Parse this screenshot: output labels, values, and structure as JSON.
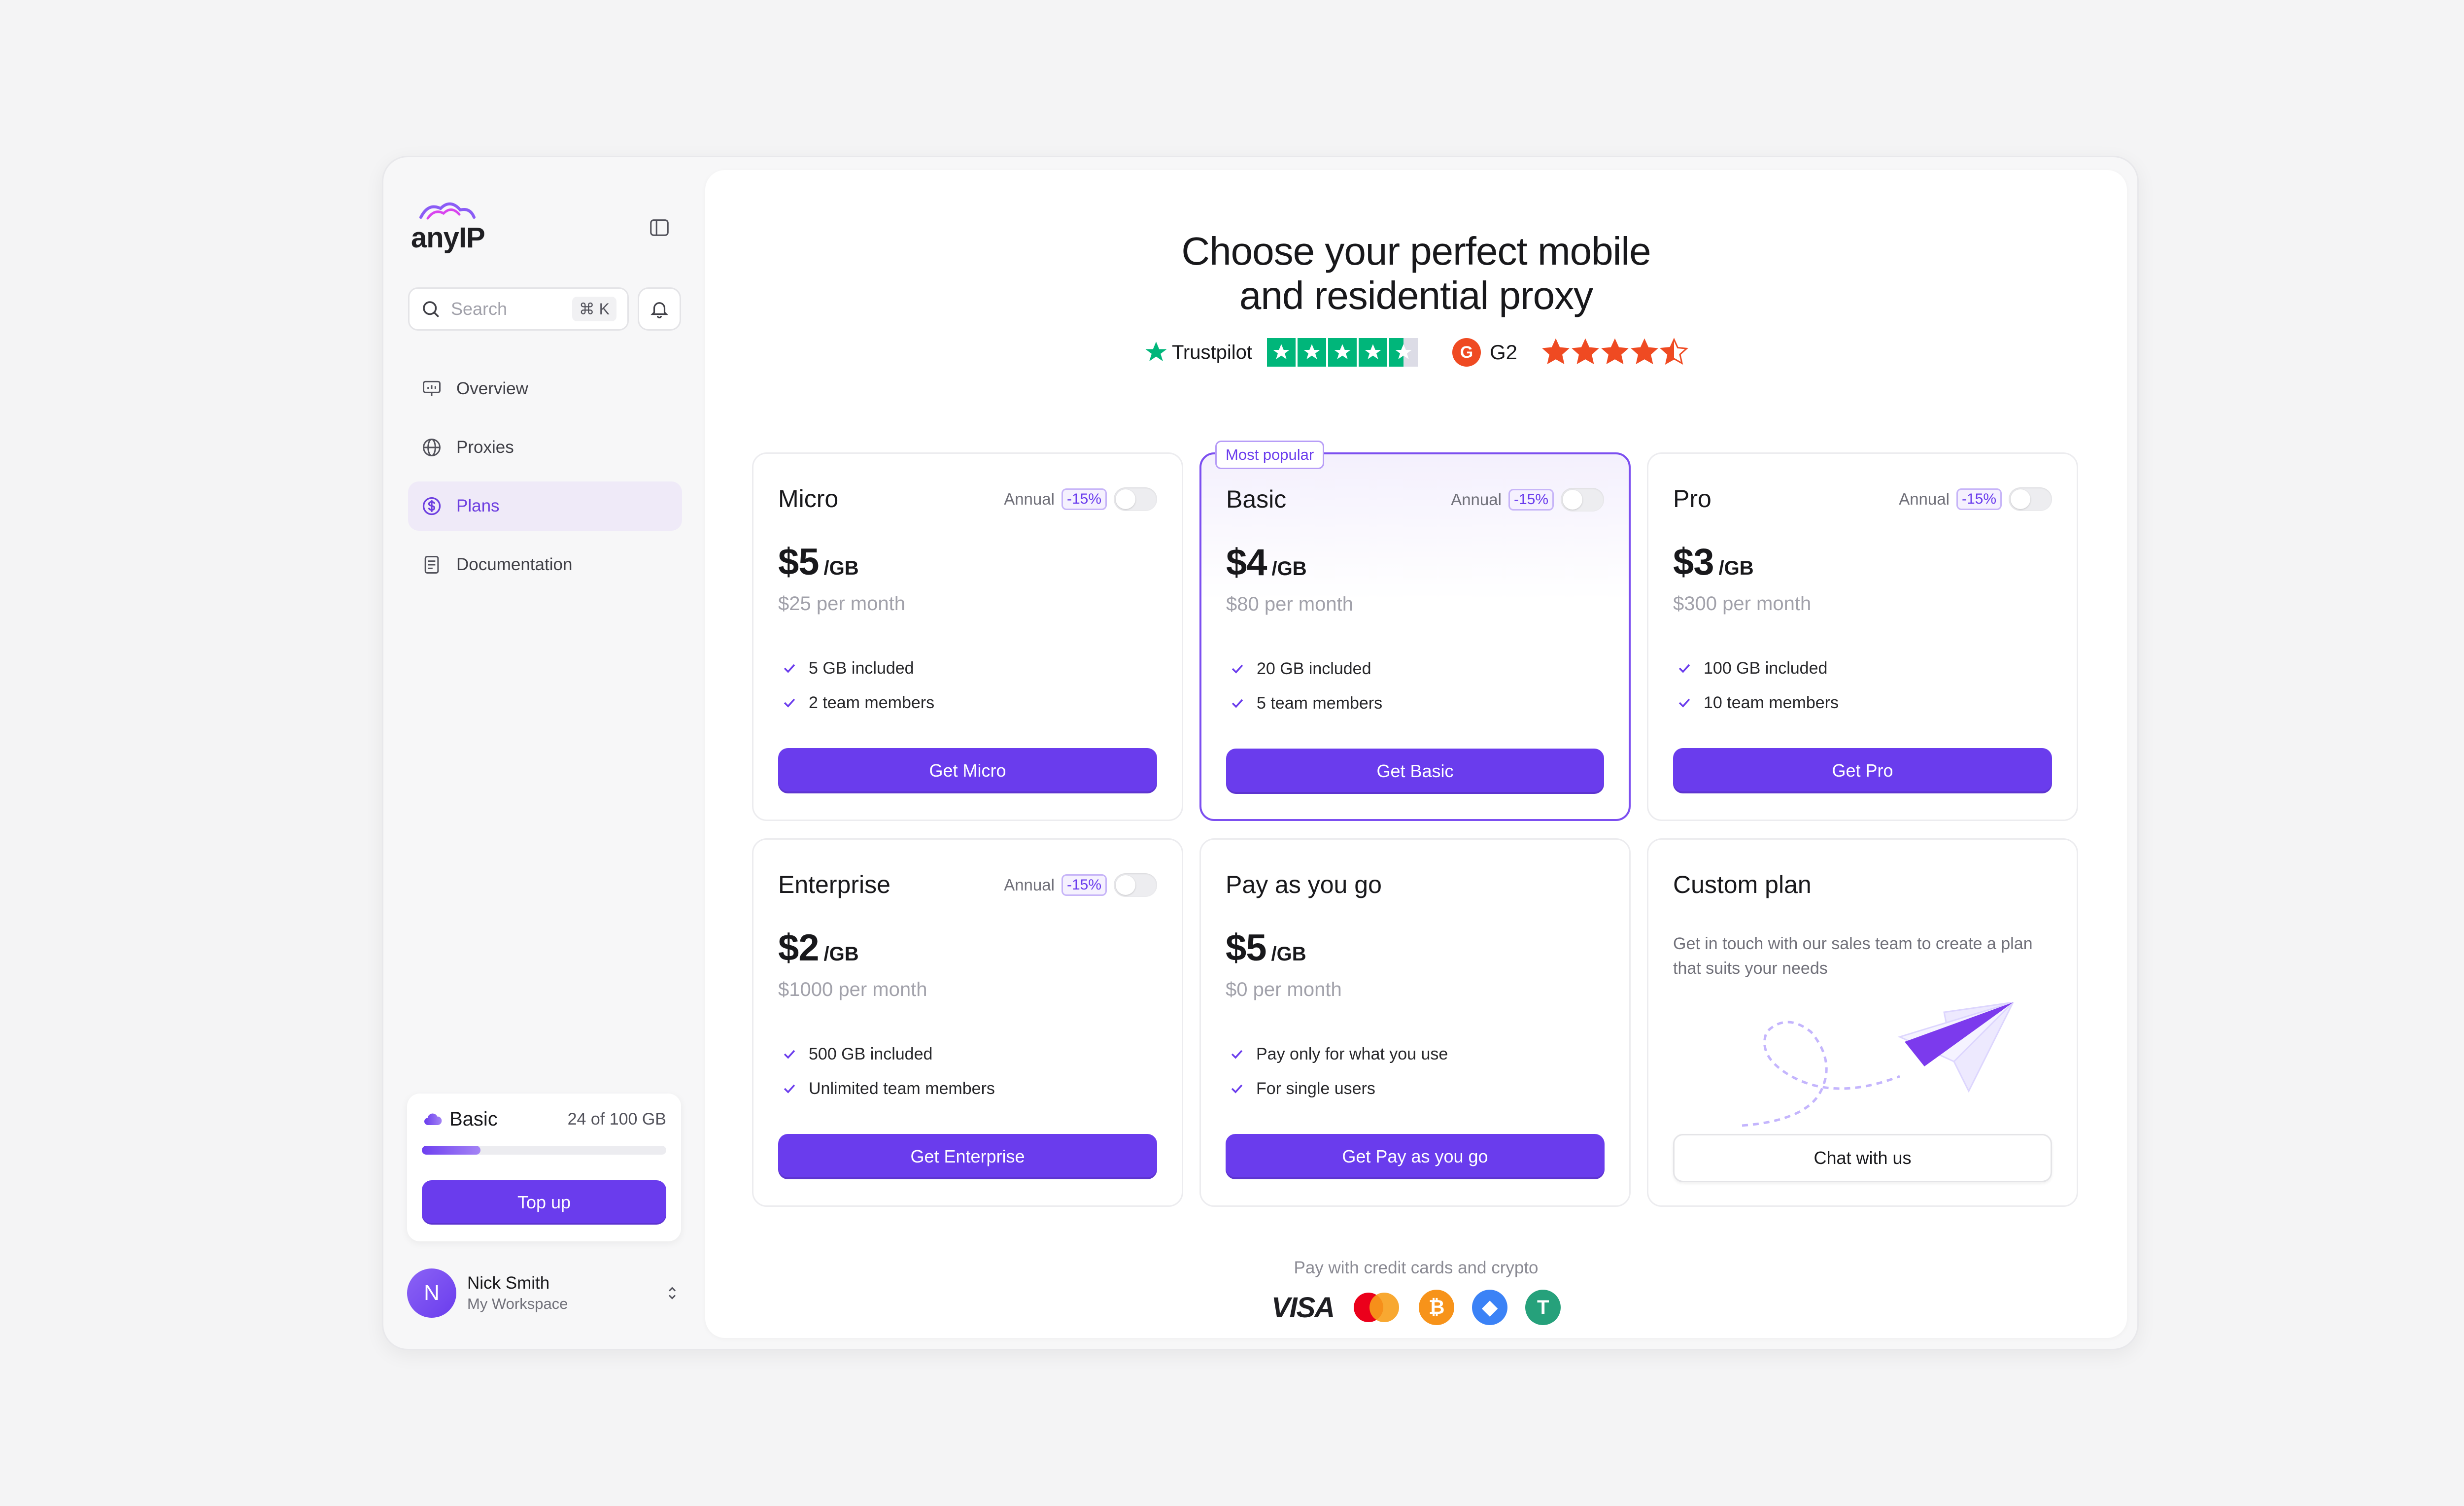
{
  "app": {
    "logo_text": "anyIP"
  },
  "search": {
    "placeholder": "Search",
    "shortcut": "⌘ K"
  },
  "sidebar": {
    "items": [
      {
        "label": "Overview",
        "icon": "presentation-chart-icon",
        "active": false
      },
      {
        "label": "Proxies",
        "icon": "globe-icon",
        "active": false
      },
      {
        "label": "Plans",
        "icon": "dollar-circle-icon",
        "active": true
      },
      {
        "label": "Documentation",
        "icon": "document-icon",
        "active": false
      }
    ],
    "plan": {
      "name": "Basic",
      "usage": "24 of 100 GB",
      "progress_fraction": 0.24,
      "topup_label": "Top up"
    },
    "user": {
      "initial": "N",
      "name": "Nick Smith",
      "workspace": "My Workspace"
    }
  },
  "main": {
    "title_line1": "Choose your perfect mobile",
    "title_line2": "and residential proxy",
    "ratings": {
      "trustpilot": {
        "name": "Trustpilot",
        "stars": 4.5
      },
      "g2": {
        "name": "G2",
        "stars": 4.5
      }
    },
    "plans": [
      {
        "name": "Micro",
        "annual_label": "Annual",
        "discount": "-15%",
        "price": "$5",
        "unit": "/GB",
        "per_month": "$25 per month",
        "features": [
          "5 GB included",
          "2 team members"
        ],
        "cta": "Get Micro"
      },
      {
        "name": "Basic",
        "badge": "Most popular",
        "annual_label": "Annual",
        "discount": "-15%",
        "price": "$4",
        "unit": "/GB",
        "per_month": "$80 per month",
        "features": [
          "20 GB included",
          "5 team members"
        ],
        "cta": "Get Basic"
      },
      {
        "name": "Pro",
        "annual_label": "Annual",
        "discount": "-15%",
        "price": "$3",
        "unit": "/GB",
        "per_month": "$300 per month",
        "features": [
          "100 GB included",
          "10 team members"
        ],
        "cta": "Get Pro"
      },
      {
        "name": "Enterprise",
        "annual_label": "Annual",
        "discount": "-15%",
        "price": "$2",
        "unit": "/GB",
        "per_month": "$1000 per month",
        "features": [
          "500 GB included",
          "Unlimited team members"
        ],
        "cta": "Get Enterprise"
      },
      {
        "name": "Pay as you go",
        "price": "$5",
        "unit": "/GB",
        "per_month": "$0 per month",
        "features": [
          "Pay only for what you use",
          "For single users"
        ],
        "cta": "Get Pay as you go"
      },
      {
        "name": "Custom plan",
        "description": "Get in touch with our sales team to create a plan that suits your needs",
        "cta": "Chat with us"
      }
    ],
    "payment": {
      "label": "Pay with credit cards and crypto",
      "visa": "VISA",
      "methods": [
        "visa",
        "mastercard",
        "bitcoin",
        "ethereum",
        "tether"
      ]
    }
  },
  "colors": {
    "accent": "#6a3ced",
    "trustpilot": "#00b67a",
    "g2": "#ef4a22"
  }
}
